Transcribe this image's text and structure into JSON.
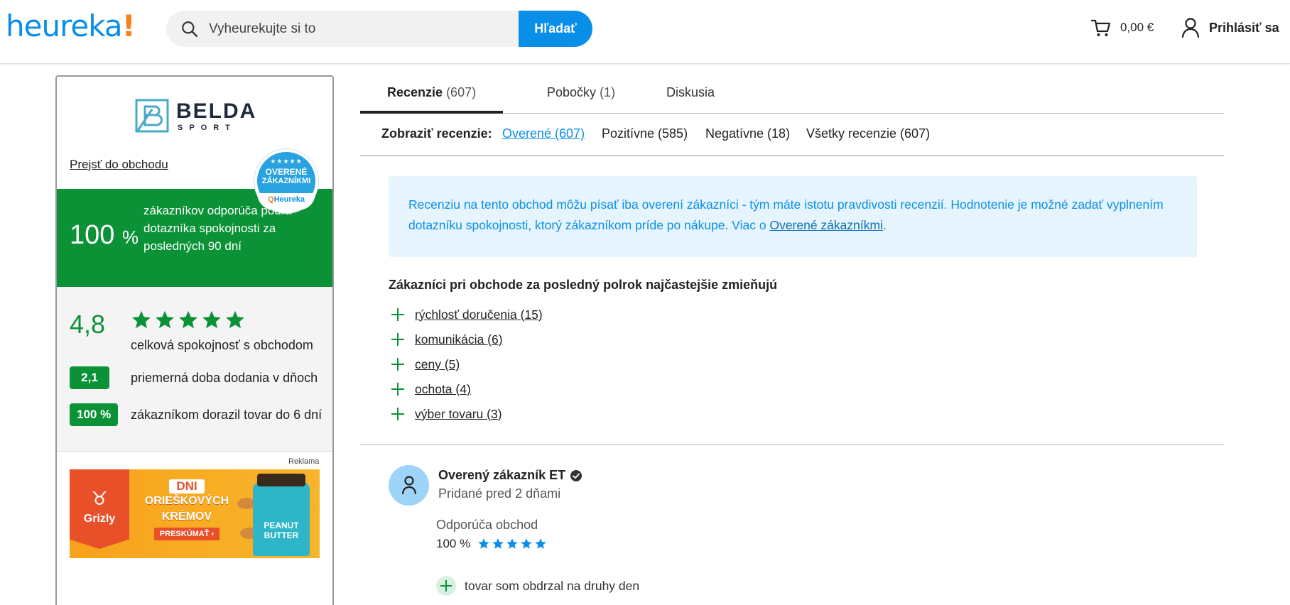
{
  "header": {
    "logo_text": "heureka",
    "logo_bang": "!",
    "search_placeholder": "Vyheurekujte si to",
    "search_button": "Hľadať",
    "cart_value": "0,00 €",
    "login_label": "Prihlásiť sa"
  },
  "shop": {
    "logo_name": "BELDA",
    "logo_sub": "SPORT",
    "goto_link": "Prejsť do obchodu",
    "recommend_pct": "100",
    "recommend_pct_sign": "%",
    "recommend_text": "zákazníkov odporúča podľa dotazníka spokojnosti za posledných 90 dní",
    "badge_line1": "OVERENÉ",
    "badge_line2": "ZÁKAZNÍKMI",
    "badge_brand": "Heureka",
    "score": "4,8",
    "score_stars": 5,
    "score_label": "celková spokojnosť s obchodom",
    "metrics": [
      {
        "value": "2,1",
        "label": "priemerná doba dodania v dňoch"
      },
      {
        "value": "100 %",
        "label": "zákazníkom dorazil tovar do 6 dní"
      }
    ],
    "ad_label": "Reklama",
    "ad": {
      "brand": "Grizly",
      "badge": "DNI",
      "line1": "ORIEŠKOVÝCH",
      "line2": "KRÉMOV",
      "cta": "PRESKÚMAŤ ›",
      "jar_line1": "PEANUT",
      "jar_line2": "BUTTER"
    }
  },
  "tabs": [
    {
      "label": "Recenzie",
      "count": "(607)",
      "active": true
    },
    {
      "label": "Pobočky",
      "count": "(1)",
      "active": false
    },
    {
      "label": "Diskusia",
      "count": "",
      "active": false
    }
  ],
  "filters": {
    "label": "Zobraziť recenzie:",
    "items": [
      {
        "label": "Overené (607)",
        "active": true
      },
      {
        "label": "Pozitívne (585)",
        "active": false
      },
      {
        "label": "Negatívne (18)",
        "active": false
      },
      {
        "label": "Všetky recenzie (607)",
        "active": false
      }
    ]
  },
  "info": {
    "text": "Recenziu na tento obchod môžu písať iba overení zákazníci - tým máte istotu pravdivosti recenzií. Hodnotenie je možné zadať vyplnením dotazníku spokojnosti, ktorý zákazníkom príde po nákupe. Viac o ",
    "link": "Overené zákazníkmi",
    "end": "."
  },
  "mentions": {
    "title": "Zákazníci pri obchode za posledný polrok najčastejšie zmieňujú",
    "items": [
      "rýchlosť doručenia (15)",
      "komunikácia (6)",
      "ceny (5)",
      "ochota (4)",
      "výber tovaru (3)"
    ]
  },
  "review": {
    "author": "Overený zákazník ET",
    "date": "Pridané pred 2 dňami",
    "recommend_label": "Odporúča obchod",
    "recommend_pct": "100 %",
    "stars": 5,
    "pro": "tovar som obdrzal na druhy den"
  },
  "colors": {
    "brand_blue": "#0a8fe8",
    "brand_orange": "#f5821f",
    "positive_green": "#0b9237",
    "info_bg": "#e6f4fd"
  }
}
